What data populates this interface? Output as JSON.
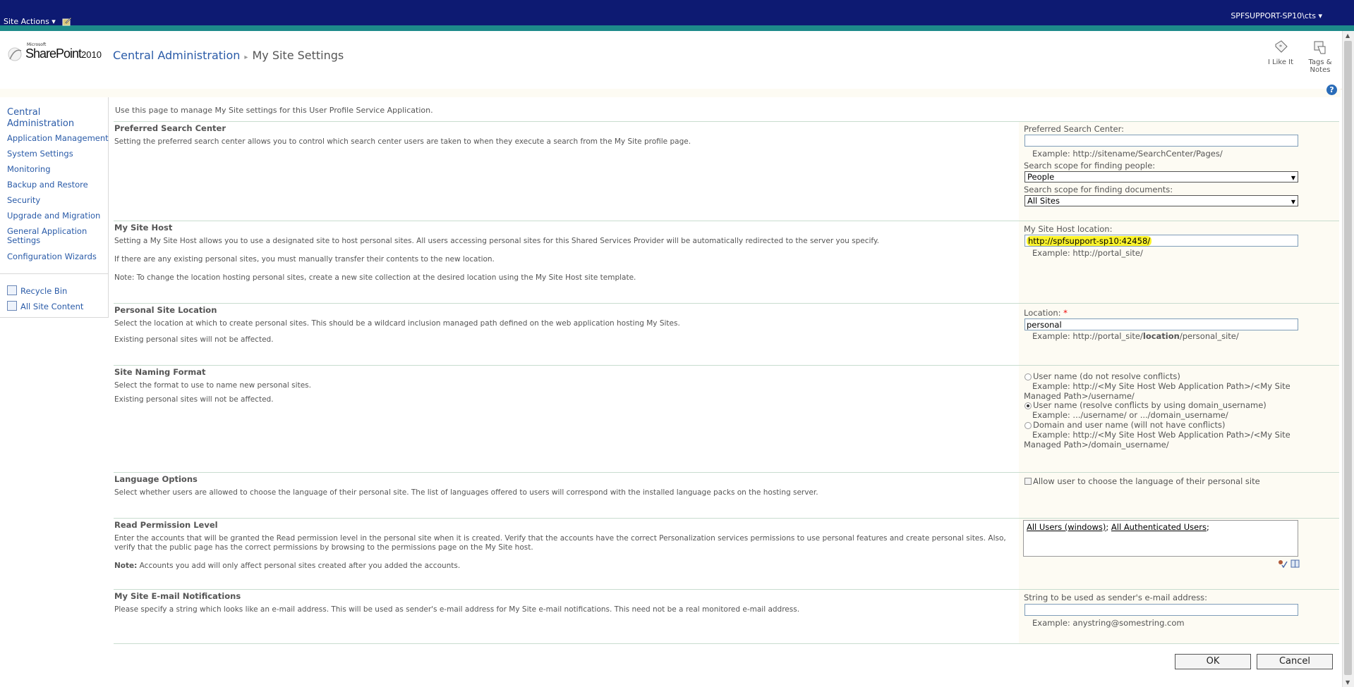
{
  "topbar": {
    "site_actions": "Site Actions ▾",
    "user": "SPFSUPPORT-SP10\\cts ▾"
  },
  "logo": {
    "microsoft": "Microsoft",
    "product": "SharePoint",
    "year": "2010"
  },
  "breadcrumb": {
    "root": "Central Administration",
    "separator": "▸",
    "current": "My Site Settings"
  },
  "social": {
    "like": "I Like It",
    "tags": "Tags & Notes"
  },
  "help": "?",
  "quicklaunch": {
    "heading": "Central Administration",
    "items": [
      "Application Management",
      "System Settings",
      "Monitoring",
      "Backup and Restore",
      "Security",
      "Upgrade and Migration",
      "General Application Settings",
      "Configuration Wizards"
    ],
    "recycle": "Recycle Bin",
    "all_content": "All Site Content"
  },
  "intro": "Use this page to manage My Site settings for this User Profile Service Application.",
  "sections": {
    "search": {
      "title": "Preferred Search Center",
      "desc": "Setting the preferred search center allows you to control which search center users are taken to when they execute a search from the My Site profile page.",
      "label": "Preferred Search Center:",
      "value": "",
      "example": "Example: http://sitename/SearchCenter/Pages/",
      "people_label": "Search scope for finding people:",
      "people_value": "People",
      "docs_label": "Search scope for finding documents:",
      "docs_value": "All Sites"
    },
    "host": {
      "title": "My Site Host",
      "desc1": "Setting a My Site Host allows you to use a designated site to host personal sites. All users accessing personal sites for this Shared Services Provider will be automatically redirected to the server you specify.",
      "desc2": "If there are any existing personal sites, you must manually transfer their contents to the new location.",
      "desc3": "Note: To change the location hosting personal sites, create a new site collection at the desired location using the My Site Host site template.",
      "label": "My Site Host location:",
      "value": "http://spfsupport-sp10:42458/",
      "example": "Example: http://portal_site/"
    },
    "location": {
      "title": "Personal Site Location",
      "desc1": "Select the location at which to create personal sites. This should be a wildcard inclusion managed path defined on the web application hosting My Sites.",
      "desc2": "Existing personal sites will not be affected.",
      "label": "Location:",
      "required": "*",
      "value": "personal",
      "example_pre": "Example: http://portal_site/",
      "example_bold": "location",
      "example_post": "/personal_site/"
    },
    "naming": {
      "title": "Site Naming Format",
      "desc1": "Select the format to use to name new personal sites.",
      "desc2": "Existing personal sites will not be affected.",
      "opt1": "User name (do not resolve conflicts)",
      "opt1_ex": "Example: http://<My Site Host Web Application Path>/<My Site Managed Path>/username/",
      "opt2": "User name (resolve conflicts by using domain_username)",
      "opt2_ex": "Example: .../username/ or .../domain_username/",
      "opt3": "Domain and user name (will not have conflicts)",
      "opt3_ex": "Example: http://<My Site Host Web Application Path>/<My Site Managed Path>/domain_username/"
    },
    "language": {
      "title": "Language Options",
      "desc": "Select whether users are allowed to choose the language of their personal site.  The list of languages offered to users will correspond with the installed language packs on the hosting server.",
      "checkbox": "Allow user to choose the language of their personal site"
    },
    "permission": {
      "title": "Read Permission Level",
      "desc1": "Enter the accounts that will be granted the Read permission level in the personal site when it is created. Verify that the accounts have the correct Personalization services permissions to use personal features and create personal sites. Also, verify that the public page has the correct permissions by browsing to the permissions page on the My Site host.",
      "note_label": "Note:",
      "note": " Accounts you add will only affect personal sites created after you added the accounts.",
      "user1": "All Users (windows)",
      "user2": "All Authenticated Users",
      "sep": ";"
    },
    "email": {
      "title": "My Site E-mail Notifications",
      "desc": "Please specify a string which looks like an e-mail address. This will be used as sender's e-mail address for My Site e-mail notifications. This need not be a real monitored e-mail address.",
      "label": "String to be used as sender's e-mail address:",
      "value": "",
      "example": "Example: anystring@somestring.com"
    }
  },
  "buttons": {
    "ok": "OK",
    "cancel": "Cancel"
  }
}
